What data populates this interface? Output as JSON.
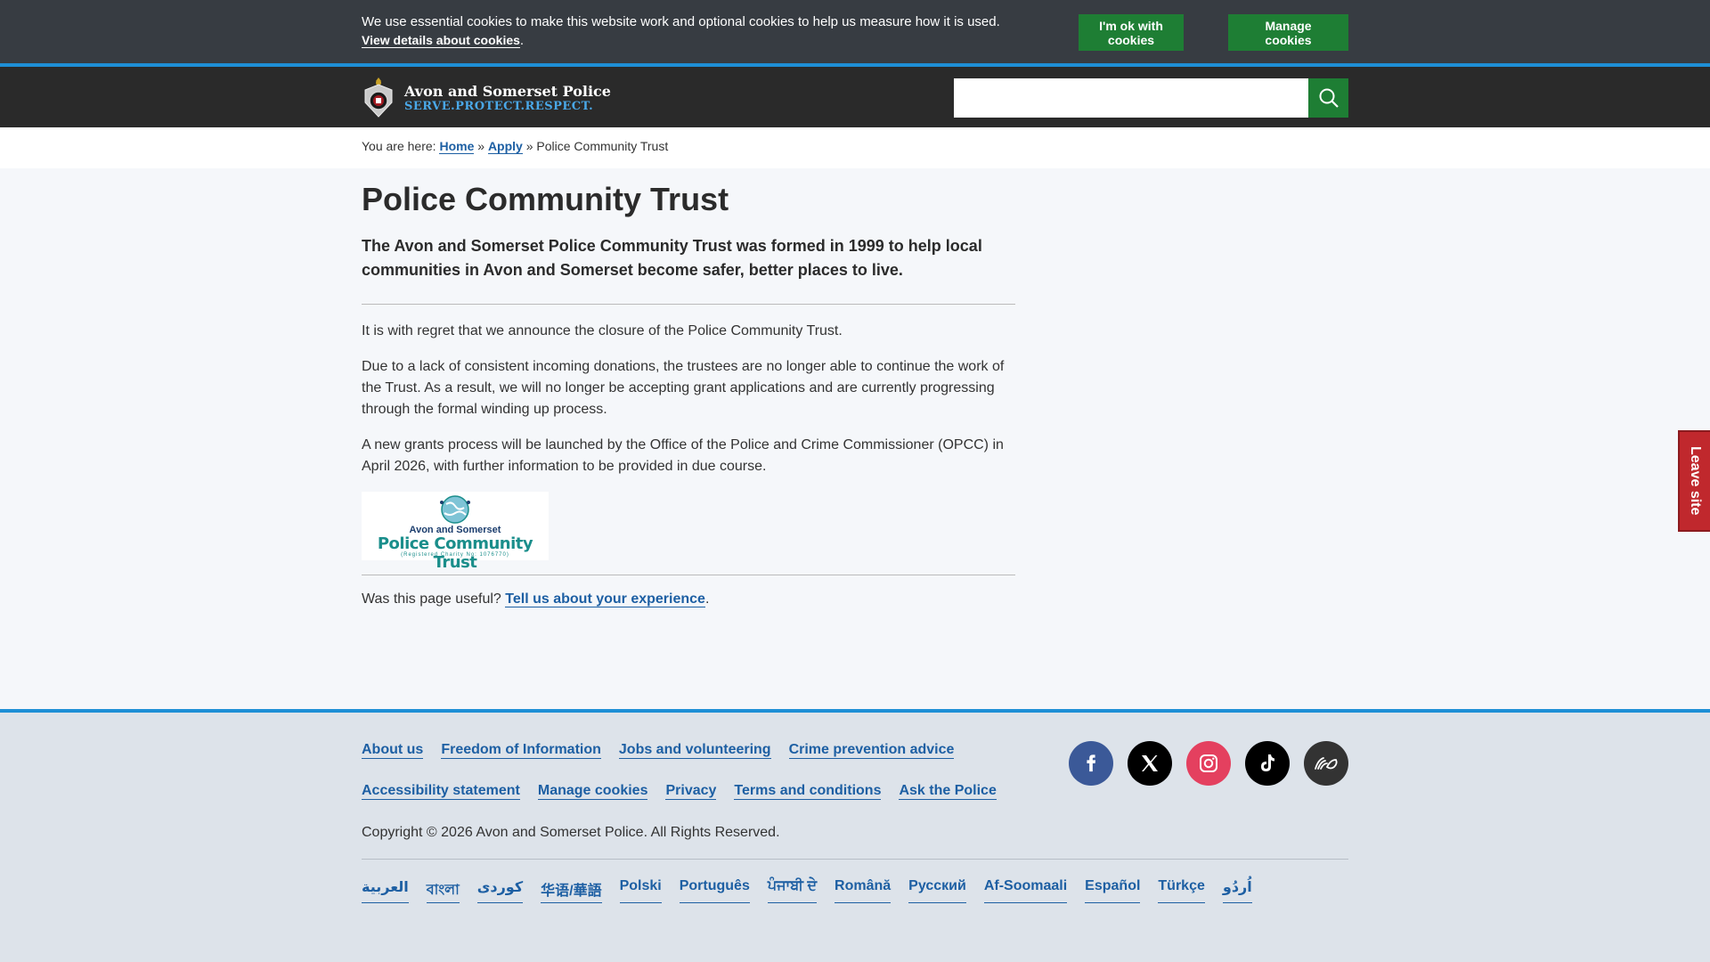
{
  "cookie_banner": {
    "text": "We use essential cookies to make this website work and optional cookies to help us measure how it is used.",
    "details_link": "View details about cookies",
    "ok_button": "I'm ok with cookies",
    "manage_button": "Manage cookies"
  },
  "header": {
    "org_name": "Avon and Somerset Police",
    "tagline": "SERVE.PROTECT.RESPECT.",
    "search_placeholder": "",
    "logo_icon": "police-crest-icon",
    "search_icon": "search-icon"
  },
  "breadcrumb": {
    "prefix": "You are here:",
    "items": [
      "Home",
      "Apply"
    ],
    "separator": "»",
    "current": "Police Community Trust"
  },
  "main": {
    "title": "Police Community Trust",
    "lead": "The Avon and Somerset Police Community Trust was formed in 1999 to help local communities in Avon and Somerset become safer, better places to live.",
    "paragraphs": [
      "It is with regret that we announce the closure of the Police Community Trust.",
      "Due to a lack of consistent incoming donations, the trustees are no longer able to continue the work of the Trust. As a result, we will no longer be accepting grant applications and are currently progressing through the formal winding up process.",
      "A new grants process will be launched by the Office of the Police and Crime Commissioner (OPCC) in April 2026, with further information to be provided in due course."
    ],
    "trust_logo": {
      "line1": "Avon and Somerset",
      "line2": "Police Community Trust",
      "line3": "(Registered Charity No: 1076770)"
    },
    "feedback_text": "Was this page useful?",
    "feedback_link": "Tell us about your experience",
    "feedback_end": "."
  },
  "leave_site": "Leave site",
  "footer": {
    "row1": [
      "About us",
      "Freedom of Information",
      "Jobs and volunteering",
      "Crime prevention advice"
    ],
    "row2": [
      "Accessibility statement",
      "Manage cookies",
      "Privacy",
      "Terms and conditions",
      "Ask the Police"
    ],
    "copyright": "Copyright © 2026 Avon and Somerset Police. All Rights Reserved.",
    "languages": [
      "العربية",
      "বাংলা",
      "کوردی",
      "华语/華語",
      "Polski",
      "Português",
      "ਪੰਜਾਬੀ ਦੇ",
      "Română",
      "Русский",
      "Af-Soomaali",
      "Español",
      "Türkçe",
      "اُردُو"
    ],
    "social": [
      "facebook-icon",
      "x-icon",
      "instagram-icon",
      "tiktok-icon",
      "sign-language-icon"
    ]
  },
  "colors": {
    "header_bg": "#2a2a2a",
    "cookie_bg": "#373c42",
    "accent_blue": "#1e8fd6",
    "link_blue": "#1d5fa3",
    "button_green": "#1e7e34",
    "leave_red": "#c0282d"
  }
}
